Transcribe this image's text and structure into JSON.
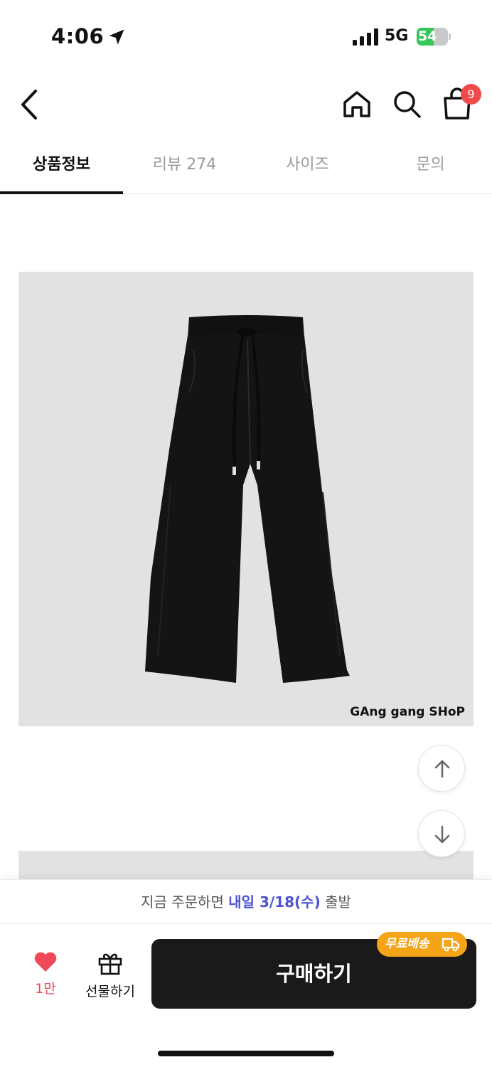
{
  "status_bar": {
    "time": "4:06",
    "network": "5G",
    "battery_percent": "54",
    "battery_level": 0.54
  },
  "header": {
    "cart_count": "9"
  },
  "tabs": [
    {
      "label": "상품정보",
      "active": true
    },
    {
      "label": "리뷰 274",
      "active": false
    },
    {
      "label": "사이즈",
      "active": false
    },
    {
      "label": "문의",
      "active": false
    }
  ],
  "product": {
    "image_watermark": "GAng gang SHoP"
  },
  "shipping": {
    "prefix": "지금 주문하면 ",
    "date": "내일 3/18(수)",
    "suffix": " 출발"
  },
  "actions": {
    "like_count": "1만",
    "gift_label": "선물하기",
    "buy_label": "구매하기",
    "free_shipping_label": "무료배송"
  },
  "colors": {
    "accent_blue": "#4a53d6",
    "like_red": "#f04a5a",
    "badge_orange": "#f6a417",
    "buy_button": "#1a1a1a"
  }
}
